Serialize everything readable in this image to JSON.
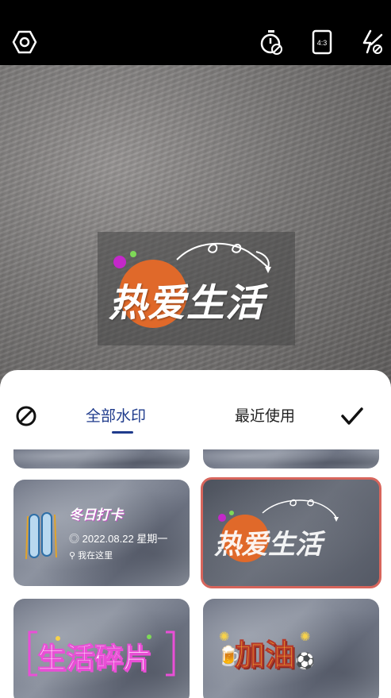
{
  "toolbar": {
    "settings_icon": "hexagon-settings-icon",
    "timer_icon": "timer-off-icon",
    "ratio_label": "4:3",
    "flash_icon": "flash-off-icon"
  },
  "preview_watermark": {
    "text": "热爱生活"
  },
  "sheet": {
    "tabs": [
      {
        "label": "全部水印",
        "active": true
      },
      {
        "label": "最近使用",
        "active": false
      }
    ],
    "none_icon": "no-watermark-icon",
    "confirm_icon": "checkmark-icon"
  },
  "watermarks": [
    {
      "title": "冬日打卡",
      "date": "2022.08.22  星期一",
      "location": "我在这里",
      "selected": false
    },
    {
      "title": "热爱生活",
      "selected": true
    },
    {
      "title": "生活碎片",
      "selected": false
    },
    {
      "title": "加油",
      "selected": false
    }
  ],
  "colors": {
    "accent": "#1f3b8c",
    "selected_border": "#d7655c",
    "orange_circle": "#e0692a",
    "magenta_dot": "#c428c9",
    "green_dot": "#7ed957"
  }
}
